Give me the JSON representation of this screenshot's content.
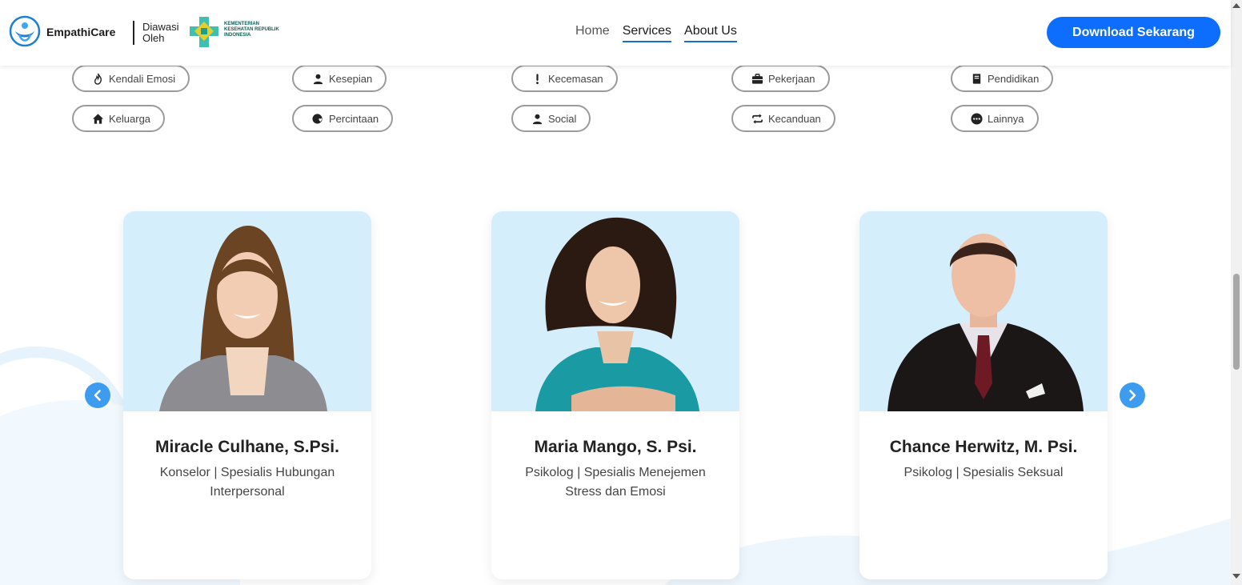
{
  "header": {
    "brand_name": "EmpathiCare",
    "supervised_by": "Diawasi Oleh",
    "ministry_logo_text": "KEMENTERIAN KESEHATAN REPUBLIK INDONESIA",
    "nav": [
      {
        "label": "Home",
        "active": false
      },
      {
        "label": "Services",
        "active": true
      },
      {
        "label": "About Us",
        "active": true
      }
    ],
    "download_label": "Download Sekarang"
  },
  "categories": [
    {
      "label": "Kendali Emosi",
      "icon": "flame-icon"
    },
    {
      "label": "Kesepian",
      "icon": "person-icon"
    },
    {
      "label": "Kecemasan",
      "icon": "exclamation-icon"
    },
    {
      "label": "Pekerjaan",
      "icon": "briefcase-icon"
    },
    {
      "label": "Pendidikan",
      "icon": "book-icon"
    },
    {
      "label": "Keluarga",
      "icon": "house-icon"
    },
    {
      "label": "Percintaan",
      "icon": "heart-hand-icon"
    },
    {
      "label": "Social",
      "icon": "person-icon"
    },
    {
      "label": "Kecanduan",
      "icon": "repeat-icon"
    },
    {
      "label": "Lainnya",
      "icon": "more-icon"
    }
  ],
  "professionals": [
    {
      "name": "Miracle Culhane, S.Psi.",
      "role": "Konselor | Spesialis Hubungan Interpersonal"
    },
    {
      "name": "Maria Mango, S. Psi.",
      "role": "Psikolog | Spesialis Menejemen Stress dan Emosi"
    },
    {
      "name": "Chance Herwitz, M. Psi.",
      "role": "Psikolog | Spesialis Seksual"
    }
  ],
  "colors": {
    "accent": "#0d6efd",
    "arrow": "#3d9bf0",
    "photo_bg": "#d5eefc",
    "nav_underline": "#1a6fbf"
  }
}
